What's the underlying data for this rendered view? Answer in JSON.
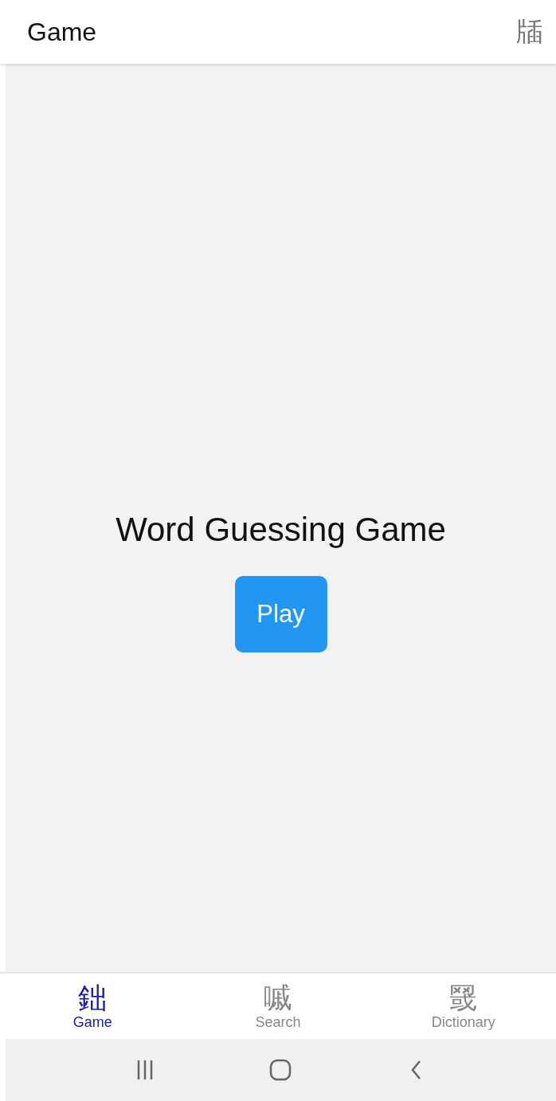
{
  "app_bar": {
    "title": "Game",
    "action_glyph": "牐"
  },
  "content": {
    "heading": "Word Guessing Game",
    "button": "Play"
  },
  "bottom_tabs": [
    {
      "glyph": "鈯",
      "label": "Game",
      "selected": true
    },
    {
      "glyph": "嘁",
      "label": "Search",
      "selected": false
    },
    {
      "glyph": "䍞",
      "label": "Dictionary",
      "selected": false
    }
  ]
}
